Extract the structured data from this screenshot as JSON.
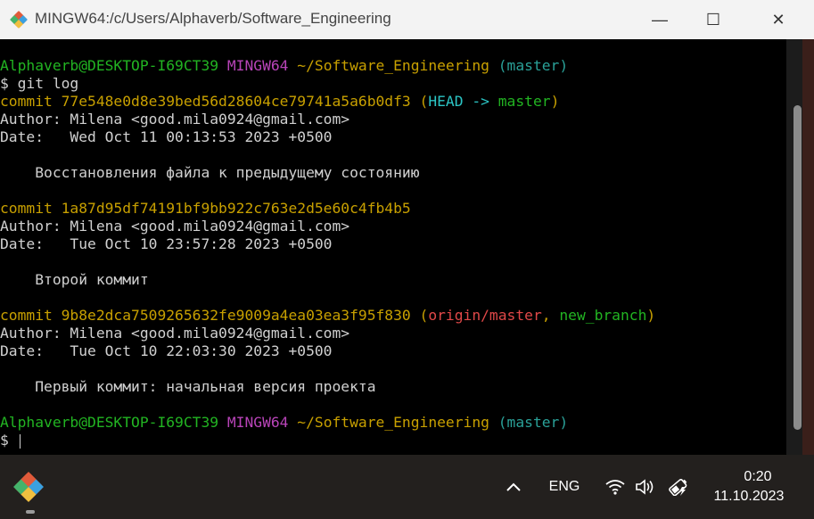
{
  "window": {
    "title": "MINGW64:/c/Users/Alphaverb/Software_Engineering"
  },
  "controls": {
    "minimize": "—",
    "maximize": "☐",
    "close": "✕"
  },
  "terminal": {
    "lines": [
      [
        {
          "t": "Alphaverb@DESKTOP-I69CT39 ",
          "c": "#22b422"
        },
        {
          "t": "MINGW64 ",
          "c": "#b844b8"
        },
        {
          "t": "~/Software_Engineering",
          "c": "#c8a000"
        },
        {
          "t": " (master)",
          "c": "#2aa198"
        }
      ],
      [
        {
          "t": "$ git log",
          "c": "#d0d0d0"
        }
      ],
      [
        {
          "t": "commit 77e548e0d8e39bed56d28604ce79741a5a6b0df3 (",
          "c": "#c8a000"
        },
        {
          "t": "HEAD -> ",
          "c": "#2bc4c4"
        },
        {
          "t": "master",
          "c": "#22b422"
        },
        {
          "t": ")",
          "c": "#c8a000"
        }
      ],
      [
        {
          "t": "Author: Milena <good.mila0924@gmail.com>",
          "c": "#d0d0d0"
        }
      ],
      [
        {
          "t": "Date:   Wed Oct 11 00:13:53 2023 +0500",
          "c": "#d0d0d0"
        }
      ],
      [
        {
          "t": "",
          "c": "#d0d0d0"
        }
      ],
      [
        {
          "t": "    Восстановления файла к предыдущему состоянию",
          "c": "#d0d0d0"
        }
      ],
      [
        {
          "t": "",
          "c": "#d0d0d0"
        }
      ],
      [
        {
          "t": "commit 1a87d95df74191bf9bb922c763e2d5e60c4fb4b5",
          "c": "#c8a000"
        }
      ],
      [
        {
          "t": "Author: Milena <good.mila0924@gmail.com>",
          "c": "#d0d0d0"
        }
      ],
      [
        {
          "t": "Date:   Tue Oct 10 23:57:28 2023 +0500",
          "c": "#d0d0d0"
        }
      ],
      [
        {
          "t": "",
          "c": "#d0d0d0"
        }
      ],
      [
        {
          "t": "    Второй коммит",
          "c": "#d0d0d0"
        }
      ],
      [
        {
          "t": "",
          "c": "#d0d0d0"
        }
      ],
      [
        {
          "t": "commit 9b8e2dca7509265632fe9009a4ea03ea3f95f830 (",
          "c": "#c8a000"
        },
        {
          "t": "origin/master",
          "c": "#e04848"
        },
        {
          "t": ", ",
          "c": "#c8a000"
        },
        {
          "t": "new_branch",
          "c": "#22b422"
        },
        {
          "t": ")",
          "c": "#c8a000"
        }
      ],
      [
        {
          "t": "Author: Milena <good.mila0924@gmail.com>",
          "c": "#d0d0d0"
        }
      ],
      [
        {
          "t": "Date:   Tue Oct 10 22:03:30 2023 +0500",
          "c": "#d0d0d0"
        }
      ],
      [
        {
          "t": "",
          "c": "#d0d0d0"
        }
      ],
      [
        {
          "t": "    Первый коммит: начальная версия проекта",
          "c": "#d0d0d0"
        }
      ],
      [
        {
          "t": "",
          "c": "#d0d0d0"
        }
      ],
      [
        {
          "t": "Alphaverb@DESKTOP-I69CT39 ",
          "c": "#22b422"
        },
        {
          "t": "MINGW64 ",
          "c": "#b844b8"
        },
        {
          "t": "~/Software_Engineering",
          "c": "#c8a000"
        },
        {
          "t": " (master)",
          "c": "#2aa198"
        }
      ],
      [
        {
          "t": "$ ",
          "c": "#d0d0d0"
        }
      ]
    ]
  },
  "taskbar": {
    "language": "ENG",
    "time": "0:20",
    "date": "11.10.2023"
  },
  "icons": {
    "app": "git-bash-icon",
    "chevron": "chevron-up-icon",
    "wifi": "wifi-icon",
    "volume": "volume-icon",
    "battery": "battery-charging-icon"
  }
}
